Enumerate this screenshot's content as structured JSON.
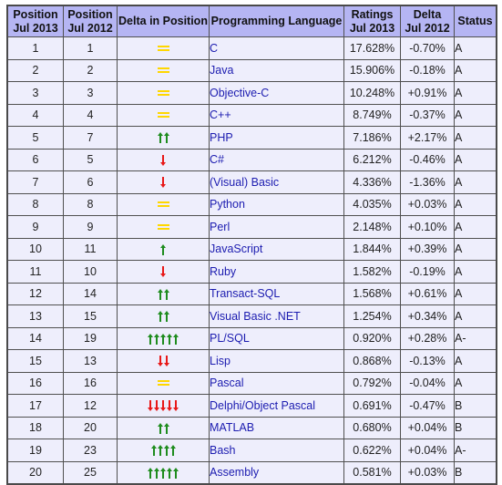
{
  "table": {
    "headers": [
      [
        "Position",
        "Jul 2013"
      ],
      [
        "Position",
        "Jul 2012"
      ],
      [
        "Delta in Position"
      ],
      [
        "Programming Language"
      ],
      [
        "Ratings",
        "Jul 2013"
      ],
      [
        "Delta",
        "Jul 2012"
      ],
      [
        "Status"
      ]
    ],
    "colors": {
      "up": "#1e8c1e",
      "down": "#e81818",
      "same": "#ffd700",
      "language": "#1c1cb0",
      "header_bg": "#b5b5f3",
      "row_bg": "#eeeefc"
    },
    "rows": [
      {
        "pos2013": "1",
        "pos2012": "1",
        "delta_icon": "equal-icon",
        "delta_dir": "same",
        "delta_count": 0,
        "language": "C",
        "rating": "17.628%",
        "delta": "-0.70%",
        "status": "A"
      },
      {
        "pos2013": "2",
        "pos2012": "2",
        "delta_icon": "equal-icon",
        "delta_dir": "same",
        "delta_count": 0,
        "language": "Java",
        "rating": "15.906%",
        "delta": "-0.18%",
        "status": "A"
      },
      {
        "pos2013": "3",
        "pos2012": "3",
        "delta_icon": "equal-icon",
        "delta_dir": "same",
        "delta_count": 0,
        "language": "Objective-C",
        "rating": "10.248%",
        "delta": "+0.91%",
        "status": "A"
      },
      {
        "pos2013": "4",
        "pos2012": "4",
        "delta_icon": "equal-icon",
        "delta_dir": "same",
        "delta_count": 0,
        "language": "C++",
        "rating": "8.749%",
        "delta": "-0.37%",
        "status": "A"
      },
      {
        "pos2013": "5",
        "pos2012": "7",
        "delta_icon": "arrow-up-icon",
        "delta_dir": "up",
        "delta_count": 2,
        "language": "PHP",
        "rating": "7.186%",
        "delta": "+2.17%",
        "status": "A"
      },
      {
        "pos2013": "6",
        "pos2012": "5",
        "delta_icon": "arrow-down-icon",
        "delta_dir": "down",
        "delta_count": 1,
        "language": "C#",
        "rating": "6.212%",
        "delta": "-0.46%",
        "status": "A"
      },
      {
        "pos2013": "7",
        "pos2012": "6",
        "delta_icon": "arrow-down-icon",
        "delta_dir": "down",
        "delta_count": 1,
        "language": "(Visual) Basic",
        "rating": "4.336%",
        "delta": "-1.36%",
        "status": "A"
      },
      {
        "pos2013": "8",
        "pos2012": "8",
        "delta_icon": "equal-icon",
        "delta_dir": "same",
        "delta_count": 0,
        "language": "Python",
        "rating": "4.035%",
        "delta": "+0.03%",
        "status": "A"
      },
      {
        "pos2013": "9",
        "pos2012": "9",
        "delta_icon": "equal-icon",
        "delta_dir": "same",
        "delta_count": 0,
        "language": "Perl",
        "rating": "2.148%",
        "delta": "+0.10%",
        "status": "A"
      },
      {
        "pos2013": "10",
        "pos2012": "11",
        "delta_icon": "arrow-up-icon",
        "delta_dir": "up",
        "delta_count": 1,
        "language": "JavaScript",
        "rating": "1.844%",
        "delta": "+0.39%",
        "status": "A"
      },
      {
        "pos2013": "11",
        "pos2012": "10",
        "delta_icon": "arrow-down-icon",
        "delta_dir": "down",
        "delta_count": 1,
        "language": "Ruby",
        "rating": "1.582%",
        "delta": "-0.19%",
        "status": "A"
      },
      {
        "pos2013": "12",
        "pos2012": "14",
        "delta_icon": "arrow-up-icon",
        "delta_dir": "up",
        "delta_count": 2,
        "language": "Transact-SQL",
        "rating": "1.568%",
        "delta": "+0.61%",
        "status": "A"
      },
      {
        "pos2013": "13",
        "pos2012": "15",
        "delta_icon": "arrow-up-icon",
        "delta_dir": "up",
        "delta_count": 2,
        "language": "Visual Basic .NET",
        "rating": "1.254%",
        "delta": "+0.34%",
        "status": "A"
      },
      {
        "pos2013": "14",
        "pos2012": "19",
        "delta_icon": "arrow-up-icon",
        "delta_dir": "up",
        "delta_count": 5,
        "language": "PL/SQL",
        "rating": "0.920%",
        "delta": "+0.28%",
        "status": "A-"
      },
      {
        "pos2013": "15",
        "pos2012": "13",
        "delta_icon": "arrow-down-icon",
        "delta_dir": "down",
        "delta_count": 2,
        "language": "Lisp",
        "rating": "0.868%",
        "delta": "-0.13%",
        "status": "A"
      },
      {
        "pos2013": "16",
        "pos2012": "16",
        "delta_icon": "equal-icon",
        "delta_dir": "same",
        "delta_count": 0,
        "language": "Pascal",
        "rating": "0.792%",
        "delta": "-0.04%",
        "status": "A"
      },
      {
        "pos2013": "17",
        "pos2012": "12",
        "delta_icon": "arrow-down-icon",
        "delta_dir": "down",
        "delta_count": 5,
        "language": "Delphi/Object Pascal",
        "rating": "0.691%",
        "delta": "-0.47%",
        "status": "B"
      },
      {
        "pos2013": "18",
        "pos2012": "20",
        "delta_icon": "arrow-up-icon",
        "delta_dir": "up",
        "delta_count": 2,
        "language": "MATLAB",
        "rating": "0.680%",
        "delta": "+0.04%",
        "status": "B"
      },
      {
        "pos2013": "19",
        "pos2012": "23",
        "delta_icon": "arrow-up-icon",
        "delta_dir": "up",
        "delta_count": 4,
        "language": "Bash",
        "rating": "0.622%",
        "delta": "+0.04%",
        "status": "A-"
      },
      {
        "pos2013": "20",
        "pos2012": "25",
        "delta_icon": "arrow-up-icon",
        "delta_dir": "up",
        "delta_count": 5,
        "language": "Assembly",
        "rating": "0.581%",
        "delta": "+0.03%",
        "status": "B"
      }
    ]
  }
}
